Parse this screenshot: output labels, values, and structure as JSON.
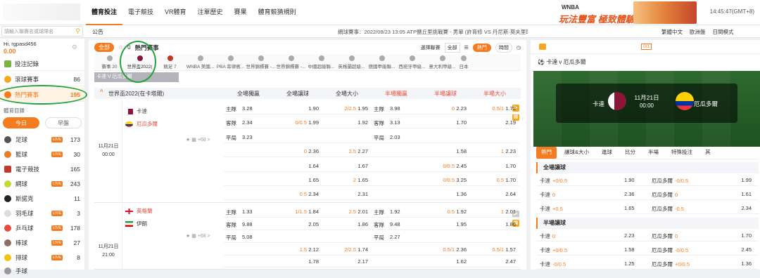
{
  "nav": {
    "items": [
      "體育投注",
      "電子競技",
      "VR體育",
      "注單歷史",
      "賽果",
      "體育競猜規則"
    ],
    "active_index": 0,
    "time": "14:45:47(GMT+8)"
  },
  "banner": {
    "brand": "WNBA",
    "slogan": "玩法豐富 極致體驗"
  },
  "search": {
    "placeholder": "請輸入聯賽名或球隊名"
  },
  "announcement": {
    "label": "公告",
    "text": "網球賽事：2022/08/23 13:05 ATP鹽丘里挑戰賽 - 男單 (許育修 VS 丹尼斯·莫夫里耶夫)- 因許"
  },
  "top_right": {
    "language": "繁體中文",
    "odds_format": "歐洲盤",
    "view": "日間模式"
  },
  "user": {
    "greeting": "Hi, rgpasd456",
    "balance": "0.00"
  },
  "sidebar": {
    "menu": [
      {
        "label": "投注記錄",
        "count": ""
      },
      {
        "label": "滾球賽事",
        "count": "86"
      },
      {
        "label": "熱門賽事",
        "count": "195"
      }
    ],
    "sports_title": "體育目錄",
    "tabs": [
      "今日",
      "早盤"
    ],
    "sports": [
      {
        "label": "足球",
        "live": true,
        "count": "173"
      },
      {
        "label": "籃球",
        "live": true,
        "count": "30"
      },
      {
        "label": "電子競技",
        "live": false,
        "count": "165"
      },
      {
        "label": "網球",
        "live": true,
        "count": "243"
      },
      {
        "label": "斯諾克",
        "live": false,
        "count": "11"
      },
      {
        "label": "羽毛球",
        "live": true,
        "count": "3"
      },
      {
        "label": "乒乓球",
        "live": true,
        "count": "178"
      },
      {
        "label": "棒球",
        "live": true,
        "count": "27"
      },
      {
        "label": "排球",
        "live": true,
        "count": "8"
      },
      {
        "label": "手球",
        "live": false,
        "count": ""
      }
    ],
    "live_badge": "LIVE"
  },
  "main": {
    "filter_all": "全部",
    "star_count": "0",
    "title": "熱門賽事",
    "sort_label": "選擇聯賽",
    "sort_value": "全部",
    "hot_btn": "熱門",
    "time_btn": "時間",
    "leagues": [
      "賽事 20",
      "世界盃2022(",
      "競足 7",
      "WNBA 美國...",
      "PBA 菲律賓...",
      "世界錦標賽 -...",
      "世界錦標賽 -...",
      "中國超級聯...",
      "英格蘭超級...",
      "德國甲級聯...",
      "西班牙甲級...",
      "意大利甲級...",
      "日本"
    ],
    "highlight": "卡達 V 厄瓜多爾",
    "group_title": "世界盃2022(在卡塔爾)",
    "columns": [
      "全場獨贏",
      "全場讓球",
      "全場大小",
      "半場獨贏",
      "半場讓球",
      "半場大小"
    ],
    "more_label": "+68 >",
    "matches": [
      {
        "date": "11月21日",
        "time": "00:00",
        "home": "卡達",
        "away": "厄瓜多爾",
        "rows": [
          [
            [
              "主隊",
              "3.28"
            ],
            [
              "",
              "1.90"
            ],
            [
              "2/2.5",
              "1.95"
            ],
            [
              "主隊",
              "3.98"
            ],
            [
              "0",
              "2.23"
            ],
            [
              "0.5/1",
              "1.72"
            ]
          ],
          [
            [
              "客隊",
              "2.34"
            ],
            [
              "0/0.5",
              "1.99"
            ],
            [
              "",
              "1.92"
            ],
            [
              "客隊",
              "3.13"
            ],
            [
              "",
              "1.70"
            ],
            [
              "",
              "2.19"
            ]
          ],
          [
            [
              "平局",
              "3.23"
            ],
            [
              "",
              ""
            ],
            [
              "",
              ""
            ],
            [
              "平局",
              "2.03"
            ],
            [
              "",
              ""
            ],
            [
              "",
              ""
            ]
          ],
          [
            [
              "",
              ""
            ],
            [
              "0",
              "2.36"
            ],
            [
              "2.5",
              "2.27"
            ],
            [
              "",
              ""
            ],
            [
              "",
              "1.58"
            ],
            [
              "1",
              "2.23"
            ]
          ],
          [
            [
              "",
              ""
            ],
            [
              "",
              "1.64"
            ],
            [
              "",
              "1.67"
            ],
            [
              "",
              ""
            ],
            [
              "0/0.5",
              "2.45"
            ],
            [
              "",
              "1.70"
            ]
          ],
          [
            [
              "",
              ""
            ],
            [
              "",
              "1.65"
            ],
            [
              "2",
              "1.65"
            ],
            [
              "",
              ""
            ],
            [
              "0/0.5",
              "3.25"
            ],
            [
              "0.5",
              "1.70"
            ]
          ],
          [
            [
              "",
              ""
            ],
            [
              "0.5",
              "2.34"
            ],
            [
              "",
              "2.31"
            ],
            [
              "",
              ""
            ],
            [
              "",
              "1.36"
            ],
            [
              "",
              "2.64"
            ]
          ]
        ]
      },
      {
        "date": "11月21日",
        "time": "21:00",
        "home": "英格蘭",
        "away": "伊朗",
        "rows": [
          [
            [
              "主隊",
              "1.33"
            ],
            [
              "1/1.5",
              "1.84"
            ],
            [
              "2.5",
              "2.01"
            ],
            [
              "主隊",
              "1.92"
            ],
            [
              "0.5",
              "1.92"
            ],
            [
              "1",
              "2.01"
            ]
          ],
          [
            [
              "客隊",
              "9.88"
            ],
            [
              "",
              "2.05"
            ],
            [
              "",
              "1.86"
            ],
            [
              "客隊",
              "9.48"
            ],
            [
              "",
              "1.95"
            ],
            [
              "",
              "1.86"
            ]
          ],
          [
            [
              "平局",
              "5.08"
            ],
            [
              "",
              ""
            ],
            [
              "",
              ""
            ],
            [
              "平局",
              "2.27"
            ],
            [
              "",
              ""
            ],
            [
              "",
              ""
            ]
          ],
          [
            [
              "",
              ""
            ],
            [
              "1.5",
              "2.12"
            ],
            [
              "2/2.5",
              "1.74"
            ],
            [
              "",
              ""
            ],
            [
              "0.5/1",
              "2.36"
            ],
            [
              "0.5/1",
              "1.57"
            ]
          ],
          [
            [
              "",
              ""
            ],
            [
              "",
              "1.78"
            ],
            [
              "",
              "2.17"
            ],
            [
              "",
              ""
            ],
            [
              "",
              "1.62"
            ],
            [
              "",
              "2.47"
            ]
          ]
        ]
      }
    ]
  },
  "right": {
    "match_title": "卡達 v 厄瓜多爾",
    "zero_badge": "0/1",
    "home": "卡達",
    "away": "厄瓜多爾",
    "date": "11月21日",
    "time": "00:00",
    "tabs": [
      "熱門",
      "讓球&大小",
      "進球",
      "比分",
      "半場",
      "特殊投注",
      "其"
    ],
    "sections": [
      {
        "title": "全場讓球",
        "rows": [
          [
            "卡達",
            "+0/0.5",
            "1.90",
            "厄瓜多爾",
            "-0/0.5",
            "1.99"
          ],
          [
            "卡達",
            "0",
            "2.36",
            "厄瓜多爾",
            "0",
            "1.61"
          ],
          [
            "卡達",
            "+0.5",
            "1.65",
            "厄瓜多爾",
            "-0.5",
            "2.34"
          ]
        ]
      },
      {
        "title": "半場讓球",
        "rows": [
          [
            "卡達",
            "0",
            "2.23",
            "厄瓜多爾",
            "0",
            "1.70"
          ],
          [
            "卡達",
            "+0/0.5",
            "1.58",
            "厄瓜多爾",
            "-0/0.5",
            "2.45"
          ],
          [
            "卡達",
            "-0/0.5",
            "1.25",
            "厄瓜多爾",
            "+0/0.5",
            "1.36"
          ]
        ]
      }
    ]
  },
  "colors": {
    "accent": "#f47b20",
    "annotation": "#25a33a",
    "half_header": "#e74c3c"
  }
}
